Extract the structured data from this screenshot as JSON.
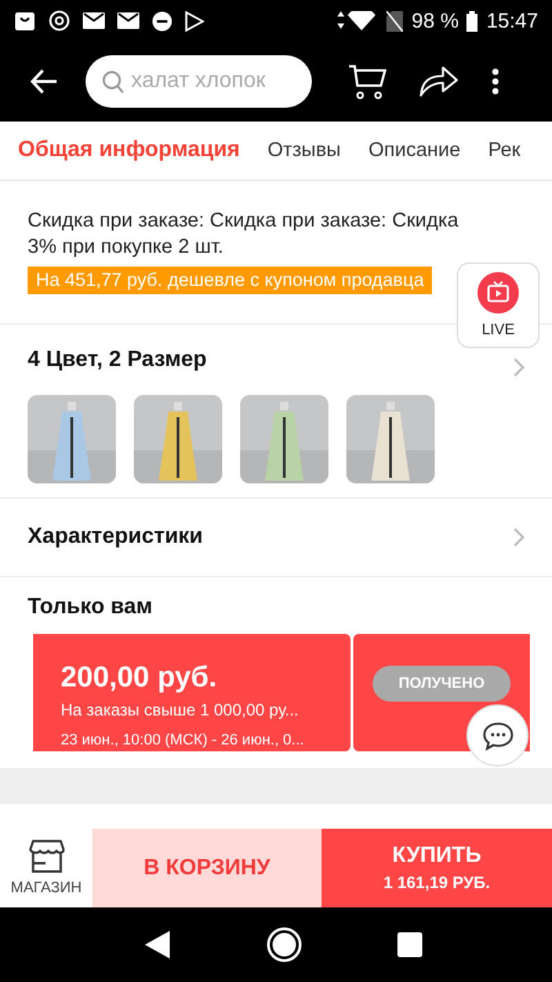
{
  "status_bar": {
    "battery": "98 %",
    "time": "15:47"
  },
  "toolbar": {
    "search": {
      "placeholder": "халат хлопок"
    }
  },
  "tabs": [
    {
      "label": "Общая информация",
      "selected": true
    },
    {
      "label": "Отзывы",
      "selected": false
    },
    {
      "label": "Описание",
      "selected": false
    },
    {
      "label": "Рек",
      "selected": false
    }
  ],
  "discount": {
    "text": "Скидка при заказе: Скидка при заказе: Скидка 3% при покупке 2 шт.",
    "coupon_tag": "На 451,77 руб. дешевле с купоном продавца"
  },
  "live": {
    "label": "LIVE"
  },
  "variants": {
    "title": "4 Цвет, 2 Размер"
  },
  "specs": {
    "title": "Характеристики"
  },
  "for_you": {
    "title": "Только вам",
    "coupon": {
      "amount": "200,00 руб.",
      "condition": "На заказы свыше 1 000,00 ру...",
      "period": "23 июн., 10:00 (МСК) - 26 июн., 0...",
      "button": "ПОЛУЧЕНО"
    }
  },
  "bottom_bar": {
    "store": "МАГАЗИН",
    "cart": "В КОРЗИНУ",
    "buy": "КУПИТЬ",
    "price": "1 161,19 РУБ."
  }
}
